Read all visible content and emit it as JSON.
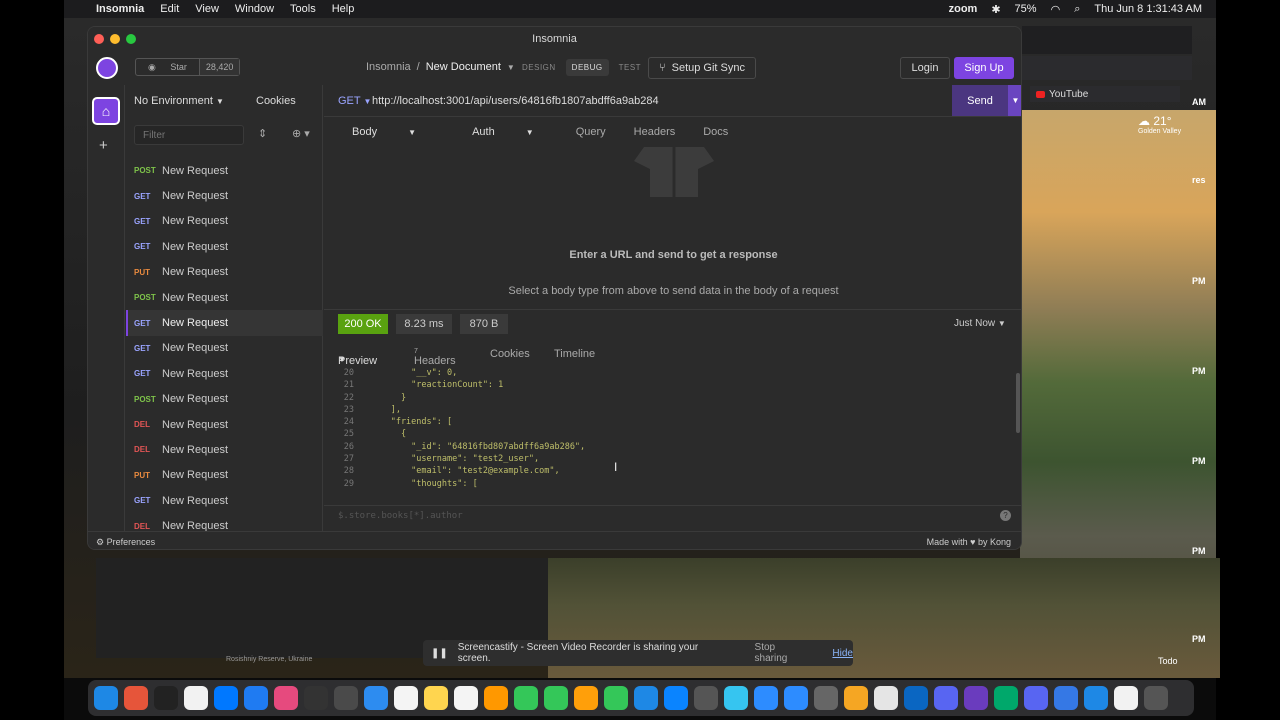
{
  "menubar": {
    "apple_icon": "apple-icon",
    "app": "Insomnia",
    "items": [
      "Edit",
      "View",
      "Window",
      "Tools",
      "Help"
    ],
    "zoom": "zoom",
    "battery": "75%",
    "datetime": "Thu Jun 8  1:31:43 AM"
  },
  "window": {
    "title": "Insomnia"
  },
  "topbar": {
    "star": "Star",
    "star_count": "28,420",
    "crumb_root": "Insomnia",
    "crumb_sep": "/",
    "document": "New Document",
    "modes": [
      "DESIGN",
      "DEBUG",
      "TEST"
    ],
    "active_mode": "DEBUG",
    "git_sync": "Setup Git Sync",
    "login": "Login",
    "signup": "Sign Up"
  },
  "sidebar": {
    "environment": "No Environment",
    "cookies": "Cookies",
    "filter_placeholder": "Filter",
    "requests": [
      {
        "method": "POST",
        "name": "New Request"
      },
      {
        "method": "GET",
        "name": "New Request"
      },
      {
        "method": "GET",
        "name": "New Request"
      },
      {
        "method": "GET",
        "name": "New Request"
      },
      {
        "method": "PUT",
        "name": "New Request"
      },
      {
        "method": "POST",
        "name": "New Request"
      },
      {
        "method": "GET",
        "name": "New Request",
        "active": true
      },
      {
        "method": "GET",
        "name": "New Request"
      },
      {
        "method": "GET",
        "name": "New Request"
      },
      {
        "method": "POST",
        "name": "New Request"
      },
      {
        "method": "DEL",
        "name": "New Request"
      },
      {
        "method": "DEL",
        "name": "New Request"
      },
      {
        "method": "PUT",
        "name": "New Request"
      },
      {
        "method": "GET",
        "name": "New Request"
      },
      {
        "method": "DEL",
        "name": "New Request"
      }
    ]
  },
  "request": {
    "method": "GET",
    "url": "http://localhost:3001/api/users/64816fb1807abdff6a9ab284",
    "send": "Send",
    "tabs": [
      "Body",
      "Auth",
      "Query",
      "Headers",
      "Docs"
    ],
    "empty_title": "Enter a URL and send to get a response",
    "empty_hint": "Select a body type from above to send data in the body of a request"
  },
  "response": {
    "status": "200 OK",
    "time": "8.23 ms",
    "size": "870 B",
    "when": "Just Now",
    "tabs": [
      "Preview",
      "Headers",
      "Cookies",
      "Timeline"
    ],
    "headers_count": "7",
    "filter_placeholder": "$.store.books[*].author",
    "lines": [
      {
        "n": "20",
        "text": "          \"__v\": 0,"
      },
      {
        "n": "21",
        "text": "          \"reactionCount\": 1"
      },
      {
        "n": "22",
        "text": "        }"
      },
      {
        "n": "23",
        "text": "      ],"
      },
      {
        "n": "24",
        "text": "      \"friends\": ["
      },
      {
        "n": "25",
        "text": "        {"
      },
      {
        "n": "26",
        "text": "          \"_id\": \"64816fbd807abdff6a9ab286\","
      },
      {
        "n": "27",
        "text": "          \"username\": \"test2_user\","
      },
      {
        "n": "28",
        "text": "          \"email\": \"test2@example.com\","
      },
      {
        "n": "29",
        "text": "          \"thoughts\": ["
      }
    ]
  },
  "statusbar": {
    "preferences": "Preferences",
    "made_with": "Made with ♥ by Kong"
  },
  "browser": {
    "tab": "YouTube",
    "temp": "21°",
    "location": "Golden Valley",
    "time_labels": [
      "AM",
      "PM",
      "PM",
      "PM",
      "PM",
      "PM"
    ],
    "todo": "Todo",
    "caption": "Rosishniy Reserve, Ukraine",
    "sliver_text": "res"
  },
  "screencastify": {
    "message": "Screencastify - Screen Video Recorder is sharing your screen.",
    "stop": "Stop sharing",
    "hide": "Hide"
  },
  "colors": {
    "accent": "#7d44e1",
    "ok": "#59a210"
  }
}
